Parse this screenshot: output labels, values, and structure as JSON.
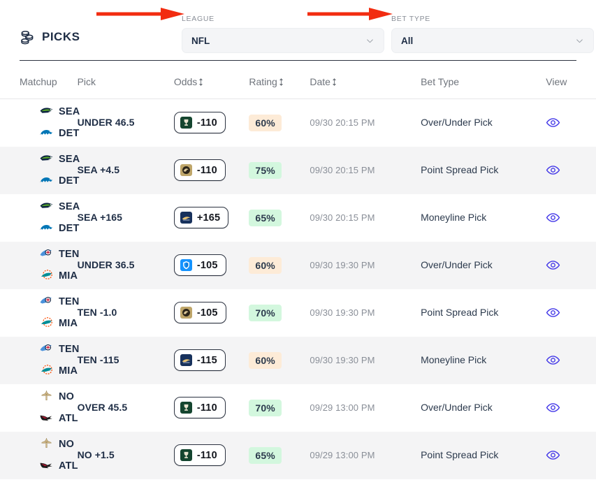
{
  "header": {
    "brand_title": "PICKS",
    "brand_icon": "coins-stack-icon",
    "league_filter": {
      "label": "LEAGUE",
      "value": "NFL",
      "chevron_icon": "chevron-down-icon"
    },
    "bettype_filter": {
      "label": "BET TYPE",
      "value": "All",
      "chevron_icon": "chevron-down-icon"
    },
    "annotations": [
      {
        "name": "red-arrow-league",
        "color": "#f22c10"
      },
      {
        "name": "red-arrow-bet-type",
        "color": "#f22c10"
      }
    ]
  },
  "table": {
    "columns": [
      {
        "key": "matchup",
        "label": "Matchup",
        "sortable": false
      },
      {
        "key": "pick",
        "label": "Pick",
        "sortable": false
      },
      {
        "key": "odds",
        "label": "Odds",
        "sortable": true,
        "sort_icon": "sort-updown-icon"
      },
      {
        "key": "rating",
        "label": "Rating",
        "sortable": true,
        "sort_icon": "sort-updown-icon"
      },
      {
        "key": "date",
        "label": "Date",
        "sortable": true,
        "sort_icon": "sort-updown-icon"
      },
      {
        "key": "bettype",
        "label": "Bet Type",
        "sortable": false
      },
      {
        "key": "view",
        "label": "View",
        "sortable": false
      }
    ],
    "rows": [
      {
        "away": "SEA",
        "home": "DET",
        "away_logo": "seahawks-logo",
        "home_logo": "lions-logo",
        "pick": "UNDER 46.5",
        "odds": "-110",
        "book": "bet365",
        "rating": "60%",
        "rating_tone": "warm",
        "date": "09/30 20:15 PM",
        "bet_type": "Over/Under Pick",
        "view_icon": "eye-icon"
      },
      {
        "away": "SEA",
        "home": "DET",
        "away_logo": "seahawks-logo",
        "home_logo": "lions-logo",
        "pick": "SEA +4.5",
        "odds": "-110",
        "book": "betmgm",
        "rating": "75%",
        "rating_tone": "good",
        "date": "09/30 20:15 PM",
        "bet_type": "Point Spread Pick",
        "view_icon": "eye-icon"
      },
      {
        "away": "SEA",
        "home": "DET",
        "away_logo": "seahawks-logo",
        "home_logo": "lions-logo",
        "pick": "SEA +165",
        "odds": "+165",
        "book": "caesars",
        "rating": "65%",
        "rating_tone": "good",
        "date": "09/30 20:15 PM",
        "bet_type": "Moneyline Pick",
        "view_icon": "eye-icon"
      },
      {
        "away": "TEN",
        "home": "MIA",
        "away_logo": "titans-logo",
        "home_logo": "dolphins-logo",
        "pick": "UNDER 36.5",
        "odds": "-105",
        "book": "fanduel",
        "rating": "60%",
        "rating_tone": "warm",
        "date": "09/30 19:30 PM",
        "bet_type": "Over/Under Pick",
        "view_icon": "eye-icon"
      },
      {
        "away": "TEN",
        "home": "MIA",
        "away_logo": "titans-logo",
        "home_logo": "dolphins-logo",
        "pick": "TEN -1.0",
        "odds": "-105",
        "book": "betmgm",
        "rating": "70%",
        "rating_tone": "good",
        "date": "09/30 19:30 PM",
        "bet_type": "Point Spread Pick",
        "view_icon": "eye-icon"
      },
      {
        "away": "TEN",
        "home": "MIA",
        "away_logo": "titans-logo",
        "home_logo": "dolphins-logo",
        "pick": "TEN -115",
        "odds": "-115",
        "book": "caesars",
        "rating": "60%",
        "rating_tone": "warm",
        "date": "09/30 19:30 PM",
        "bet_type": "Moneyline Pick",
        "view_icon": "eye-icon"
      },
      {
        "away": "NO",
        "home": "ATL",
        "away_logo": "saints-logo",
        "home_logo": "falcons-logo",
        "pick": "OVER 45.5",
        "odds": "-110",
        "book": "bet365",
        "rating": "70%",
        "rating_tone": "good",
        "date": "09/29 13:00 PM",
        "bet_type": "Over/Under Pick",
        "view_icon": "eye-icon"
      },
      {
        "away": "NO",
        "home": "ATL",
        "away_logo": "saints-logo",
        "home_logo": "falcons-logo",
        "pick": "NO +1.5",
        "odds": "-110",
        "book": "bet365",
        "rating": "65%",
        "rating_tone": "good",
        "date": "09/29 13:00 PM",
        "bet_type": "Point Spread Pick",
        "view_icon": "eye-icon"
      }
    ]
  },
  "colors": {
    "accent_eye": "#4338e8",
    "text_dark": "#1e2d45",
    "text_muted": "#8a8f98",
    "row_alt": "#f4f4f5",
    "arrow_red": "#f22c10",
    "rating_warm_bg": "#fdebd7",
    "rating_good_bg": "#d3f7de"
  }
}
